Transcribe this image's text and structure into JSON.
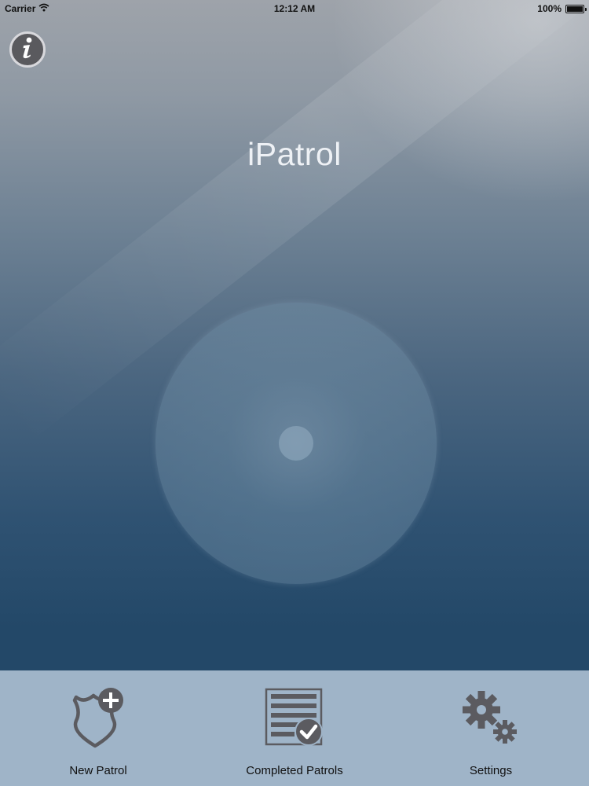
{
  "status_bar": {
    "carrier": "Carrier",
    "time": "12:12 AM",
    "battery": "100%",
    "battery_level": 1.0
  },
  "header": {
    "info_icon": "info-icon",
    "title": "iPatrol"
  },
  "tab_bar": {
    "items": [
      {
        "label": "New Patrol",
        "icon": "shield-plus-icon"
      },
      {
        "label": "Completed Patrols",
        "icon": "document-check-icon"
      },
      {
        "label": "Settings",
        "icon": "gears-icon"
      }
    ]
  },
  "colors": {
    "tab_bar_bg": "#9fb4c8",
    "icon_gray": "#5b5b60",
    "title_text": "#eef1f5"
  }
}
